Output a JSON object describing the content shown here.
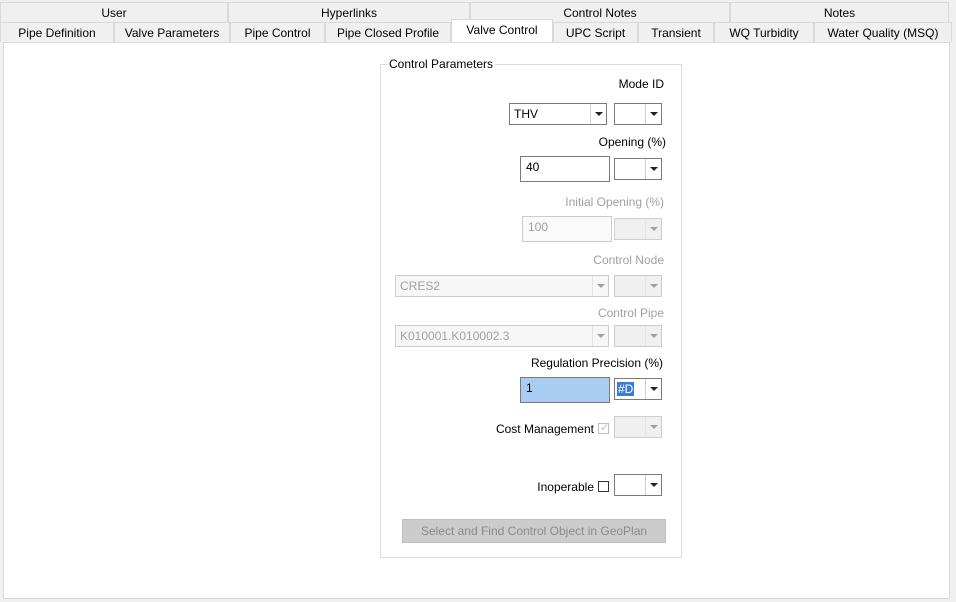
{
  "tabs_row1": [
    {
      "label": "User"
    },
    {
      "label": "Hyperlinks"
    },
    {
      "label": "Control Notes"
    },
    {
      "label": "Notes"
    }
  ],
  "tabs_row2": [
    {
      "label": "Pipe Definition"
    },
    {
      "label": "Valve Parameters"
    },
    {
      "label": "Pipe Control"
    },
    {
      "label": "Pipe Closed Profile"
    },
    {
      "label": "Valve Control"
    },
    {
      "label": "UPC Script"
    },
    {
      "label": "Transient"
    },
    {
      "label": "WQ Turbidity"
    },
    {
      "label": "Water Quality (MSQ)"
    }
  ],
  "active_tab": "Valve Control",
  "group": {
    "title": "Control Parameters",
    "mode_id": {
      "label": "Mode ID",
      "value": "THV",
      "flag": ""
    },
    "opening": {
      "label": "Opening (%)",
      "value": "40",
      "flag": ""
    },
    "initial_opening": {
      "label": "Initial Opening (%)",
      "value": "100",
      "flag": "",
      "disabled": true
    },
    "control_node": {
      "label": "Control Node",
      "value": "CRES2",
      "flag": "",
      "disabled": true
    },
    "control_pipe": {
      "label": "Control Pipe",
      "value": "K010001.K010002.3",
      "flag": "",
      "disabled": true
    },
    "regulation_precision": {
      "label": "Regulation Precision (%)",
      "value": "1",
      "flag": "#D"
    },
    "cost_management": {
      "label": "Cost Management",
      "checked": true,
      "disabled": true,
      "flag": ""
    },
    "inoperable": {
      "label": "Inoperable",
      "checked": false,
      "flag": ""
    },
    "select_button": "Select and Find Control Object in GeoPlan"
  },
  "colors": {
    "panel": "#ffffff",
    "background": "#f0f0f0",
    "selection": "#3b7bdc",
    "highlight": "#a9ccf2"
  }
}
